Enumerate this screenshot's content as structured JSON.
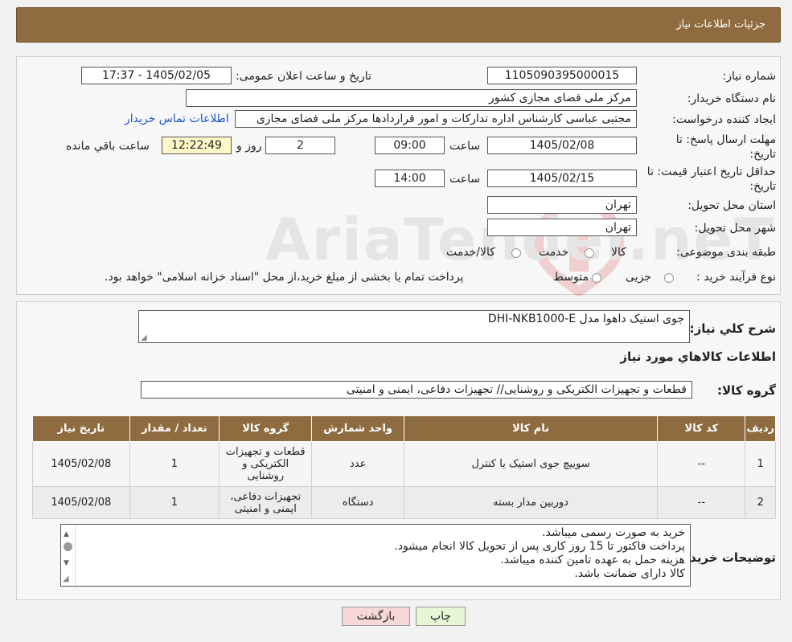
{
  "header": {
    "title": "جزئیات اطلاعات نیاز"
  },
  "form": {
    "need_number_label": "شماره نیاز:",
    "need_number_value": "1105090395000015",
    "announce_label": "تاریخ و ساعت اعلان عمومی:",
    "announce_value": "1405/02/05 - 17:37",
    "buyer_org_label": "نام دستگاه خریدار:",
    "buyer_org_value": "مرکز ملی فضای مجازی کشور",
    "creator_label": "ایجاد کننده درخواست:",
    "creator_value": "مجتبی عباسی کارشناس اداره تدارکات و امور قراردادها مرکز ملی فضای مجازی",
    "contact_link": "اطلاعات تماس خریدار",
    "deadline_label_1": "مهلت ارسال پاسخ: تا",
    "deadline_label_2": "تاریخ:",
    "deadline_date": "1405/02/08",
    "time_label": "ساعت",
    "deadline_time": "09:00",
    "days_value": "2",
    "days_label": "روز و",
    "remaining_time": "12:22:49",
    "remaining_label": "ساعت باقي مانده",
    "validity_label_1": "حداقل تاریخ اعتبار قیمت: تا",
    "validity_label_2": "تاریخ:",
    "validity_date": "1405/02/15",
    "validity_time": "14:00",
    "province_label": "استان محل تحویل:",
    "province_value": "تهران",
    "city_label": "شهر محل تحویل:",
    "city_value": "تهران",
    "category_label": "طبقه بندی موضوعی:",
    "category_options": [
      "کالا",
      "خدمت",
      "کالا/خدمت"
    ],
    "process_label": "نوع فرآیند خرید :",
    "process_options": [
      "جزیی",
      "متوسط"
    ],
    "process_note": "پرداخت تمام یا بخشی از مبلغ خرید،از محل \"اسناد خزانه اسلامی\" خواهد بود."
  },
  "watermark": {
    "text": "AriaTender.neT"
  },
  "description": {
    "label": "شرح کلي نياز:",
    "value": "جوی استیک داهوا مدل DHI-NKB1000-E"
  },
  "goods": {
    "section_title": "اطلاعات کالاهاي مورد نياز",
    "group_label": "گروه کالا:",
    "group_value": "قطعات و تجهیزات الکتریکی و روشنایی// تجهیزات دفاعی، ایمنی و امنیتی"
  },
  "table": {
    "headers": [
      "رديف",
      "کد کالا",
      "نام کالا",
      "واحد شمارش",
      "گروه کالا",
      "تعداد / مقدار",
      "تاریخ نیاز"
    ],
    "rows": [
      [
        "1",
        "--",
        "سوییچ جوی استیک یا کنترل",
        "عدد",
        "قطعات و تجهیزات الکتریکی و روشنایی",
        "1",
        "1405/02/08"
      ],
      [
        "2",
        "--",
        "دوربین مدار بسته",
        "دستگاه",
        "تجهیزات دفاعی، ایمنی و امنیتی",
        "1",
        "1405/02/08"
      ]
    ]
  },
  "buyer_notes": {
    "label": "توضیحات خریدار:",
    "lines": [
      "خرید به صورت رسمی میباشد.",
      "پرداخت فاکتور تا 15 روز کاری پس از تحویل کالا انجام میشود.",
      "هزینه حمل به عهده تامین کننده میباشد.",
      "کالا دارای ضمانت باشد."
    ]
  },
  "buttons": {
    "print": "چاپ",
    "back": "بازگشت"
  },
  "colors": {
    "header_bg": "#8f6c3f",
    "link": "#1a55c9",
    "print_btn": "#e6f7d6",
    "back_btn": "#f8d7d7"
  }
}
